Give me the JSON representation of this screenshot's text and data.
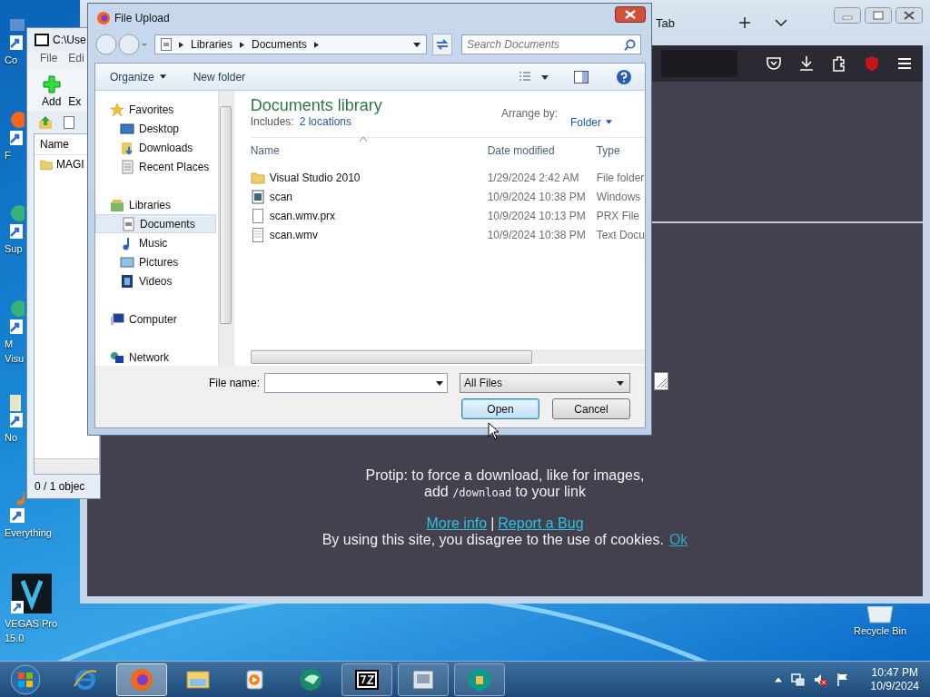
{
  "desktop": {
    "icons": [
      {
        "kind": "computer",
        "lines": [
          "Co"
        ]
      },
      {
        "kind": "firefox",
        "lines": [
          "F"
        ]
      },
      {
        "kind": "globe",
        "lines": [
          "Sup"
        ]
      },
      {
        "kind": "globe",
        "lines": [
          "M",
          "Visu"
        ]
      },
      {
        "kind": "notepad",
        "lines": [
          "No"
        ]
      },
      {
        "kind": "search",
        "lines": [
          "Everything"
        ]
      },
      {
        "kind": "vegas",
        "lines": [
          "VEGAS Pro",
          "15.0"
        ]
      }
    ],
    "recycle_bin": {
      "label": "Recycle Bin"
    }
  },
  "browser": {
    "tab": "Tab",
    "protip": {
      "before": "Protip: to force a download, like for images,",
      "add": "add",
      "code": "/download",
      "after": "to your link"
    },
    "links": [
      {
        "label": "More info"
      },
      {
        "label": "Report a Bug"
      }
    ],
    "separator": "|",
    "cookie_notice": "By using this site, you disagree to the use of cookies.",
    "cookie_ok": "Ok"
  },
  "archiver": {
    "title": "C:\\Use",
    "menu": [
      "File",
      "Edi"
    ],
    "toolbar": [
      "Add",
      "Ex"
    ],
    "column": "Name",
    "rows": [
      "MAGI"
    ],
    "status": "0 / 1 objec"
  },
  "dialog": {
    "title": "File Upload",
    "breadcrumb": [
      "Libraries",
      "Documents"
    ],
    "search": {
      "placeholder": "Search Documents"
    },
    "toolbar": [
      "Organize",
      "New folder"
    ],
    "nav": [
      {
        "label": "Favorites",
        "kind": "star",
        "selected": false,
        "children": [
          {
            "label": "Desktop",
            "kind": "desktop",
            "selected": false
          },
          {
            "label": "Downloads",
            "kind": "downloads",
            "selected": false
          },
          {
            "label": "Recent Places",
            "kind": "recent",
            "selected": false
          }
        ]
      },
      {
        "label": "Libraries",
        "kind": "libraries",
        "selected": false,
        "children": [
          {
            "label": "Documents",
            "kind": "documents",
            "selected": true
          },
          {
            "label": "Music",
            "kind": "music",
            "selected": false
          },
          {
            "label": "Pictures",
            "kind": "pictures",
            "selected": false
          },
          {
            "label": "Videos",
            "kind": "videos",
            "selected": false
          }
        ]
      },
      {
        "label": "Computer",
        "kind": "computer",
        "selected": false
      },
      {
        "label": "Network",
        "kind": "network",
        "selected": false
      }
    ],
    "library": {
      "heading": "Documents library",
      "includes_label": "Includes:",
      "includes_link": "2 locations",
      "arrange_label": "Arrange by:",
      "arrange_value": "Folder"
    },
    "columns": [
      "Name",
      "Date modified",
      "Type"
    ],
    "rows": [
      {
        "kind": "folder",
        "name": "Visual Studio 2010",
        "date": "1/29/2024 2:42 AM",
        "type": "File folder"
      },
      {
        "kind": "video",
        "name": "scan",
        "date": "10/9/2024 10:38 PM",
        "type": "Windows"
      },
      {
        "kind": "file",
        "name": "scan.wmv.prx",
        "date": "10/9/2024 10:13 PM",
        "type": "PRX File"
      },
      {
        "kind": "text",
        "name": "scan.wmv",
        "date": "10/9/2024 10:38 PM",
        "type": "Text Docu"
      }
    ],
    "file_name_label": "File name:",
    "filter": "All Files",
    "buttons": [
      "Open",
      "Cancel"
    ]
  },
  "taskbar": {
    "items": [
      {
        "kind": "ie",
        "running": false,
        "selected": false
      },
      {
        "kind": "firefox",
        "running": true,
        "selected": true
      },
      {
        "kind": "explorer",
        "running": false,
        "selected": false
      },
      {
        "kind": "media",
        "running": false,
        "selected": false
      },
      {
        "kind": "sphere",
        "running": false,
        "selected": false
      },
      {
        "kind": "sevenzip",
        "running": true,
        "selected": false
      },
      {
        "kind": "window",
        "running": true,
        "selected": false
      },
      {
        "kind": "shield",
        "running": true,
        "selected": false
      }
    ],
    "time": "10:47 PM",
    "date": "10/9/2024"
  }
}
